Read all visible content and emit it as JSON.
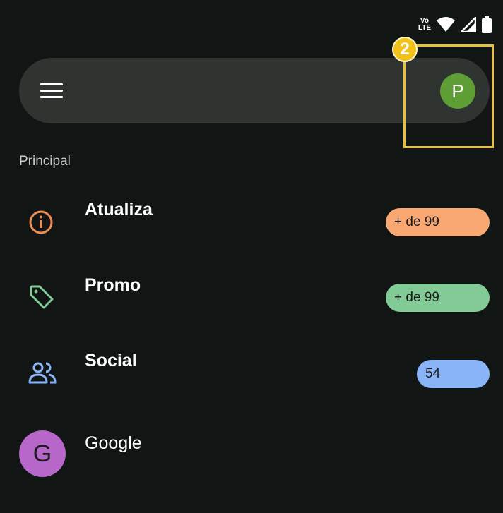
{
  "status_bar": {
    "volte_line1": "Vo",
    "volte_line2": "LTE"
  },
  "search_bar": {
    "avatar_letter": "P",
    "avatar_color": "#5e9e34"
  },
  "annotation": {
    "step_number": "2",
    "color": "#e8c13a"
  },
  "section": {
    "title": "Principal"
  },
  "categories": [
    {
      "label": "Atualiza",
      "icon": "info-icon",
      "badge": "+ de 99",
      "badge_color": "#f9a874"
    },
    {
      "label": "Promo",
      "icon": "tag-icon",
      "badge": "+ de 99",
      "badge_color": "#83cb96"
    },
    {
      "label": "Social",
      "icon": "people-icon",
      "badge": "54",
      "badge_color": "#8ab4f8"
    }
  ],
  "senders": [
    {
      "avatar_letter": "G",
      "name": "Google",
      "avatar_color": "#b667c9"
    }
  ]
}
